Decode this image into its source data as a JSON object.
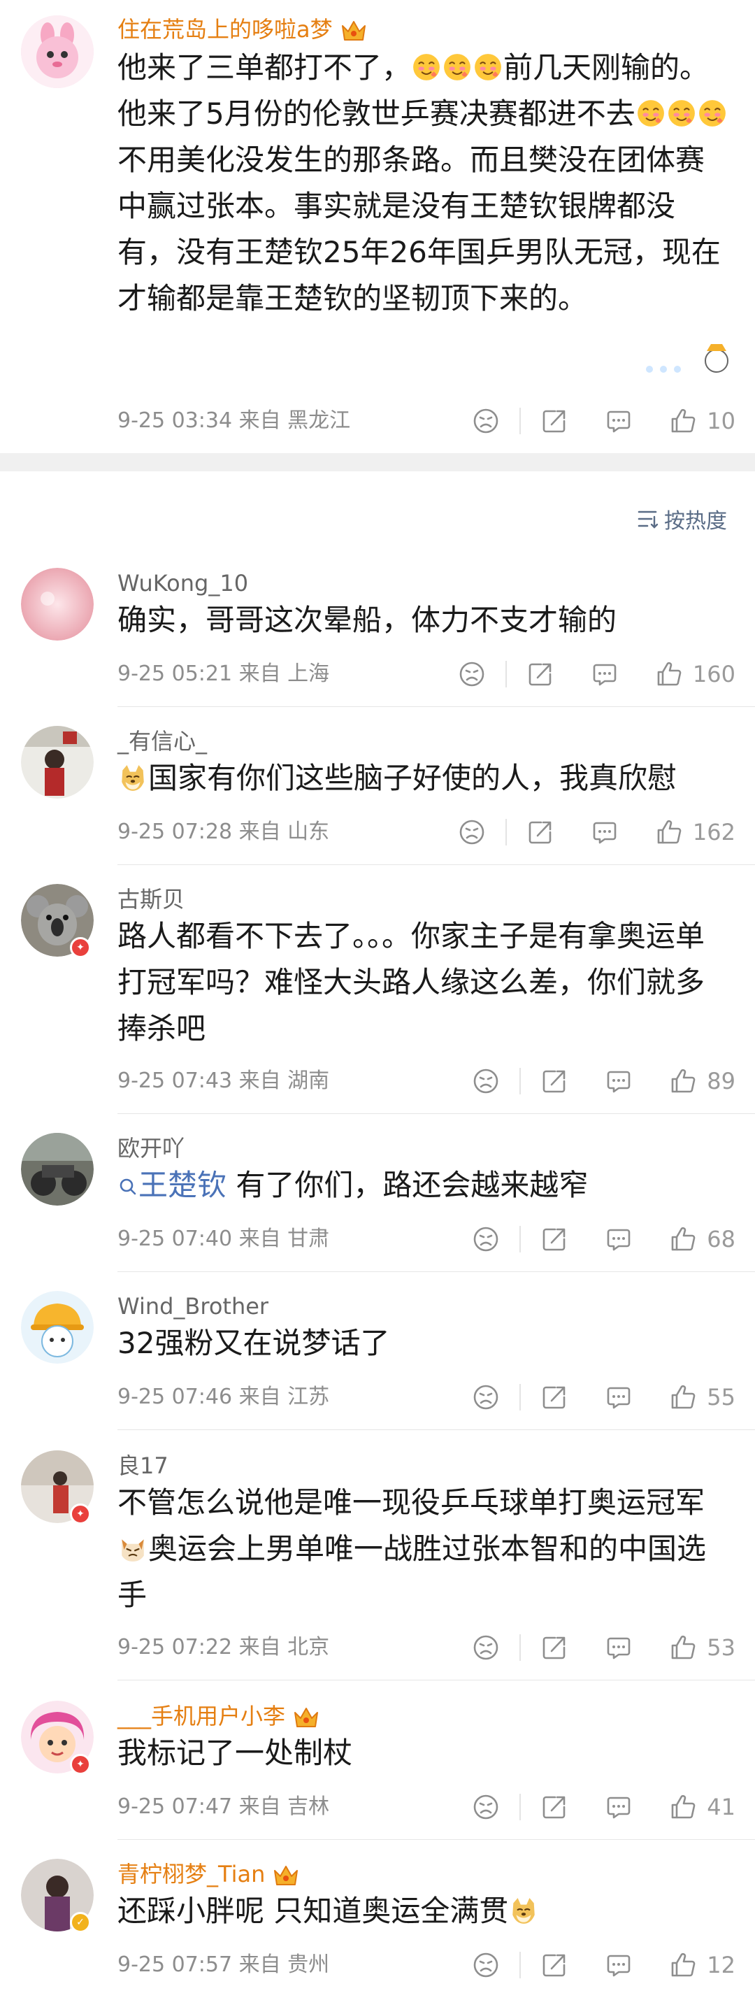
{
  "top_comment": {
    "username": "住在荒岛上的哆啦a梦",
    "text_a": "他来了三单都打不了，",
    "text_b": "前几天刚输的。他来了5月份的伦敦世乒赛决赛都进不去",
    "text_c": "不用美化没发生的那条路。而且樊没在团体赛中赢过张本。事实就是没有王楚钦银牌都没有，没有王楚钦25年26年国乒男队无冠，现在才输都是靠王楚钦的坚韧顶下来的。",
    "meta": "9-25 03:34 来自 黑龙江",
    "likes": "10"
  },
  "sort": {
    "icon": "sort-lines-icon",
    "label": "按热度"
  },
  "comments": [
    {
      "username": "WuKong_10",
      "text": "确实，哥哥这次晕船，体力不支才输的",
      "meta": "9-25 05:21 来自 上海",
      "likes": "160"
    },
    {
      "username": "_有信心_",
      "text": "国家有你们这些脑子好使的人，我真欣慰",
      "meta": "9-25 07:28 来自 山东",
      "likes": "162"
    },
    {
      "username": "古斯贝",
      "text": "路人都看不下去了。。。你家主子是有拿奥运单打冠军吗？难怪大头路人缘这么差，你们就多捧杀吧",
      "meta": "9-25 07:43 来自 湖南",
      "likes": "89"
    },
    {
      "username": "欧开吖",
      "link": "王楚钦",
      "text": " 有了你们，路还会越来越窄",
      "meta": "9-25 07:40 来自 甘肃",
      "likes": "68"
    },
    {
      "username": "Wind_Brother",
      "text": "32强粉又在说梦话了",
      "meta": "9-25 07:46 来自 江苏",
      "likes": "55"
    },
    {
      "username": "良17",
      "text_a": "不管怎么说他是唯一现役乒乓球单打奥运冠军",
      "text_b": "奥运会上男单唯一战胜过张本智和的中国选手",
      "meta": "9-25 07:22 来自 北京",
      "likes": "53"
    },
    {
      "username": "___手机用户小李",
      "text": "我标记了一处制杖",
      "meta": "9-25 07:47 来自 吉林",
      "likes": "41"
    },
    {
      "username": "青柠栩梦_Tian",
      "text": "还踩小胖呢 只知道奥运全满贯",
      "meta": "9-25 07:57 来自 贵州",
      "likes": "12"
    }
  ],
  "colors": {
    "vip_name": "#e57f12",
    "meta": "#8d8d8d",
    "link": "#4a72b7",
    "section_gap": "#f0f0f0"
  },
  "icons": [
    "dislike-face-icon",
    "share-icon",
    "comment-icon",
    "thumb-up-icon",
    "crown-icon",
    "search-icon",
    "emoji-icon"
  ]
}
